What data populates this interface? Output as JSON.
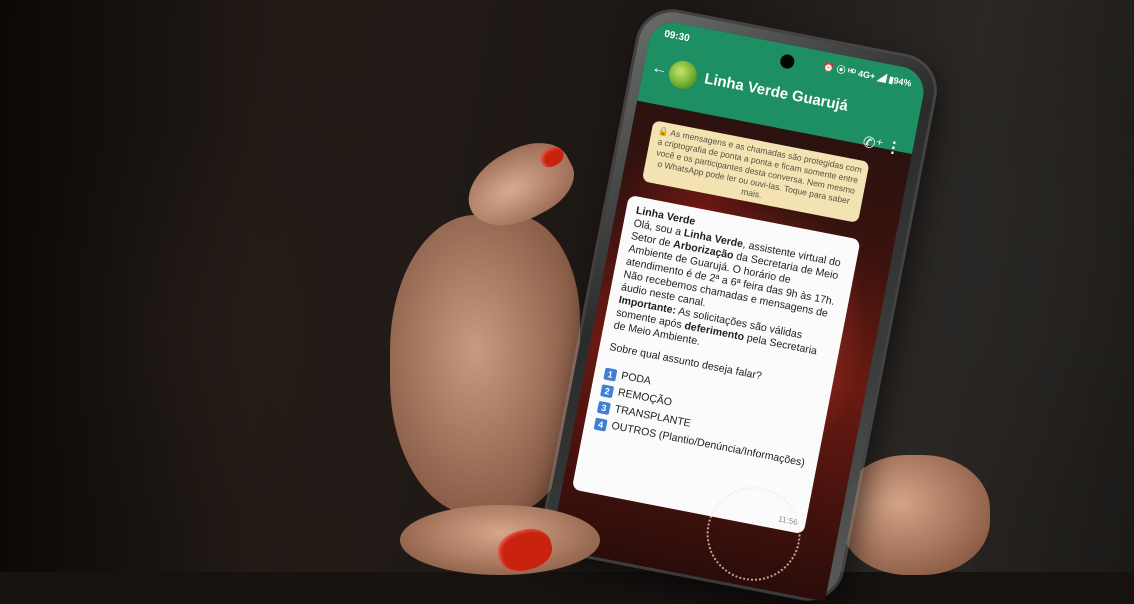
{
  "phone": {
    "status_time": "09:30",
    "status_indicators": "⏰ ⦿ ᴴᴰ 4G+ ◢ ▮94%",
    "chat_title": "Linha Verde Guarujá",
    "icons": [
      "back-arrow-icon",
      "avatar",
      "add-call-icon",
      "more-vert-icon"
    ]
  },
  "notice": {
    "text": "🔒 As mensagens e as chamadas são protegidas com a criptografia de ponta a ponta e ficam somente entre você e os participantes desta conversa. Nem mesmo o WhatsApp pode ler ou ouvi-las. Toque para saber mais."
  },
  "message": {
    "sender": "Linha Verde",
    "intro_1": "Olá, sou a ",
    "intro_bold_1": "Linha Verde",
    "intro_2": ", assistente virtual do Setor de ",
    "intro_bold_2": "Arborização",
    "intro_3": " da Secretaria de Meio Ambiente de Guarujá. O horário de atendimento é de 2ª a 6ª feira das 9h às 17h. Não recebemos chamadas e mensagens de áudio neste canal.",
    "important_label": "Importante:",
    "important_1": " As solicitações são válidas somente após ",
    "important_bold": "deferimento",
    "important_2": " pela Secretaria de Meio Ambiente.",
    "question": "Sobre qual assunto deseja falar?",
    "options": [
      {
        "key": "1",
        "label": "PODA"
      },
      {
        "key": "2",
        "label": "REMOÇÃO"
      },
      {
        "key": "3",
        "label": "TRANSPLANTE"
      },
      {
        "key": "4",
        "label": "OUTROS (Plantio/Denúncia/Informações)"
      }
    ],
    "time": "11:56"
  }
}
